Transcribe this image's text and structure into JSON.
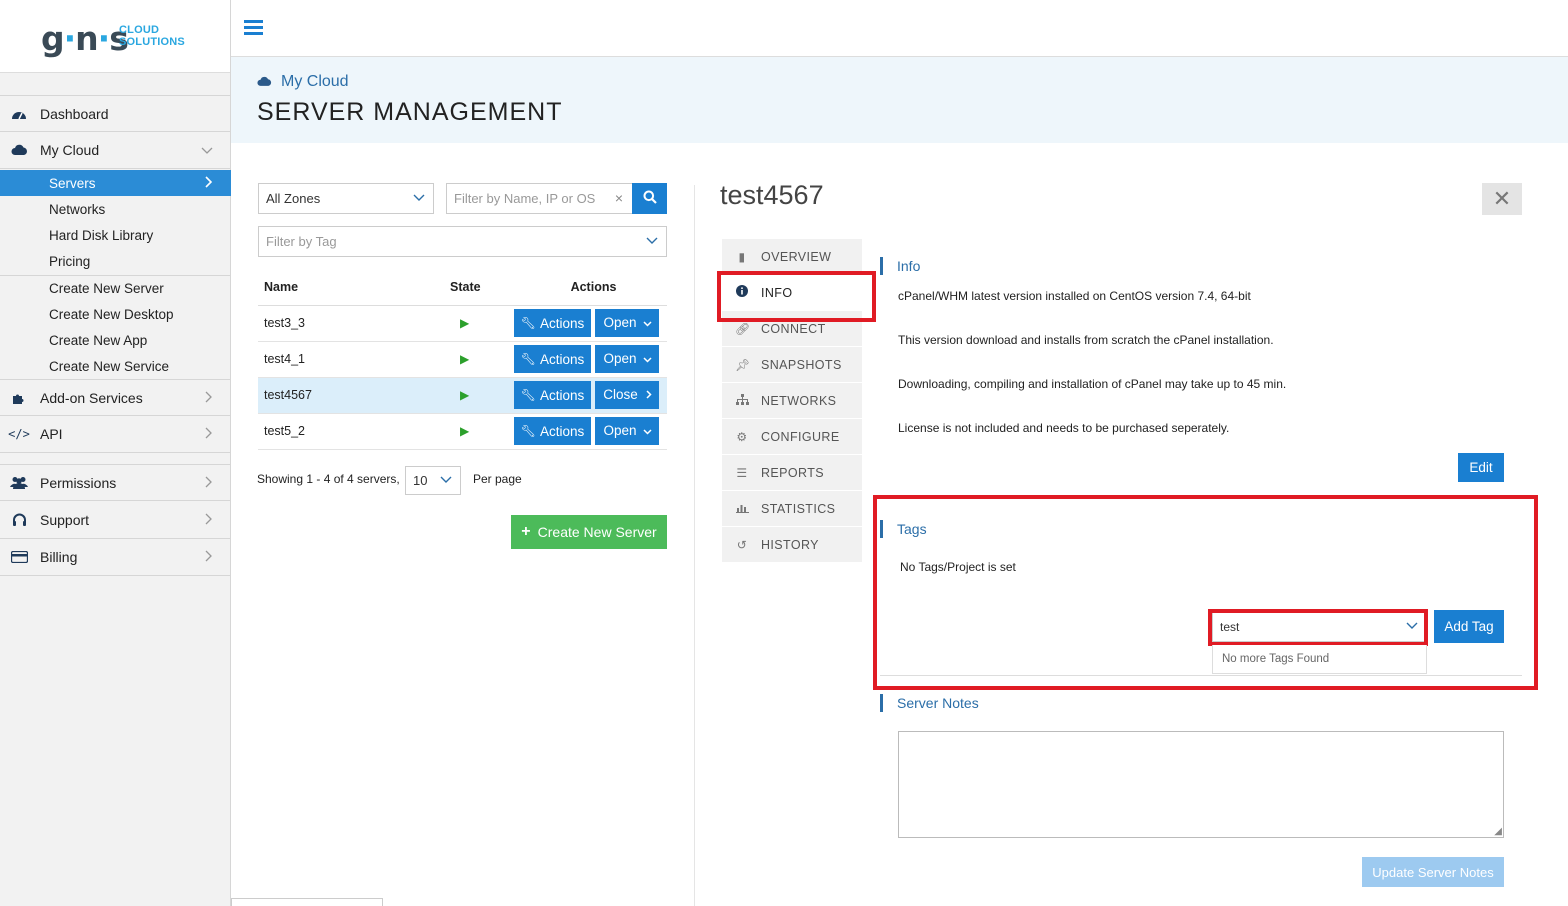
{
  "brand": {
    "logo": "gns",
    "logo_line1": "CLOUD",
    "logo_line2": "SOLUTIONS",
    "accent": "#2aa7e0"
  },
  "sidebar": {
    "items": [
      {
        "label": "Dashboard",
        "icon": "dashboard-icon"
      },
      {
        "label": "My Cloud",
        "icon": "cloud-icon"
      },
      {
        "label": "Add-on Services",
        "icon": "puzzle-icon"
      },
      {
        "label": "API",
        "icon": "code-icon"
      },
      {
        "label": "Permissions",
        "icon": "users-icon"
      },
      {
        "label": "Support",
        "icon": "headset-icon"
      },
      {
        "label": "Billing",
        "icon": "credit-card-icon"
      }
    ],
    "mycloud_sub": [
      "Servers",
      "Networks",
      "Hard Disk Library",
      "Pricing"
    ],
    "create_sub": [
      "Create New Server",
      "Create New Desktop",
      "Create New App",
      "Create New Service"
    ]
  },
  "header": {
    "breadcrumb": "My Cloud",
    "title": "SERVER MANAGEMENT"
  },
  "filters": {
    "zone": "All Zones",
    "search_placeholder": "Filter by Name, IP or OS",
    "tag_placeholder": "Filter by Tag"
  },
  "table": {
    "headers": [
      "Name",
      "State",
      "Actions"
    ],
    "rows": [
      {
        "name": "test3_3",
        "action": "Actions",
        "toggle": "Open"
      },
      {
        "name": "test4_1",
        "action": "Actions",
        "toggle": "Open"
      },
      {
        "name": "test4567",
        "action": "Actions",
        "toggle": "Close"
      },
      {
        "name": "test5_2",
        "action": "Actions",
        "toggle": "Open"
      }
    ],
    "showing": "Showing 1 - 4 of 4 servers,",
    "per_page_value": "10",
    "per_page_label": "Per page"
  },
  "create_button": "Create New Server",
  "detail": {
    "server_name": "test4567",
    "tabs": [
      "OVERVIEW",
      "INFO",
      "CONNECT",
      "SNAPSHOTS",
      "NETWORKS",
      "CONFIGURE",
      "REPORTS",
      "STATISTICS",
      "HISTORY"
    ],
    "active_tab": "INFO",
    "info_title": "Info",
    "info_lines": [
      "cPanel/WHM latest version installed on CentOS version 7.4, 64-bit",
      "This version download and installs from scratch the cPanel installation.",
      "Downloading, compiling and installation of cPanel may take up to 45 min.",
      "License is not included and needs to be purchased seperately."
    ],
    "edit_button": "Edit",
    "tags_title": "Tags",
    "tags_empty": "No Tags/Project is set",
    "tag_input_value": "test",
    "tag_dropdown_msg": "No more Tags Found",
    "add_tag_button": "Add Tag",
    "notes_title": "Server Notes",
    "update_notes_button": "Update Server Notes"
  }
}
